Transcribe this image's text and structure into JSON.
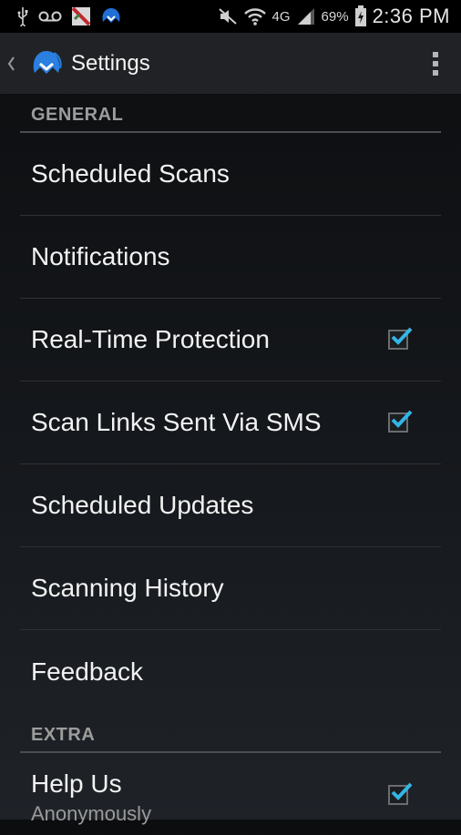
{
  "status_bar": {
    "icons_left": [
      "usb-icon",
      "voicemail-icon",
      "kaspersky-app-icon",
      "malwarebytes-app-icon"
    ],
    "network": "4G",
    "battery": "69%",
    "time": "2:36 PM"
  },
  "action_bar": {
    "title": "Settings"
  },
  "sections": {
    "general": {
      "header": "GENERAL",
      "items": [
        {
          "label": "Scheduled Scans"
        },
        {
          "label": "Notifications"
        },
        {
          "label": "Real-Time Protection",
          "checked": true
        },
        {
          "label": "Scan Links Sent Via SMS",
          "checked": true
        },
        {
          "label": "Scheduled Updates"
        },
        {
          "label": "Scanning History"
        },
        {
          "label": "Feedback"
        }
      ]
    },
    "extra": {
      "header": "EXTRA",
      "items": [
        {
          "label": "Help Us",
          "sublabel": "Anonymously",
          "checked": true
        }
      ]
    }
  },
  "colors": {
    "accent": "#33b5e5",
    "action_bar": "#202225",
    "section_header": "#9c9c9c"
  }
}
